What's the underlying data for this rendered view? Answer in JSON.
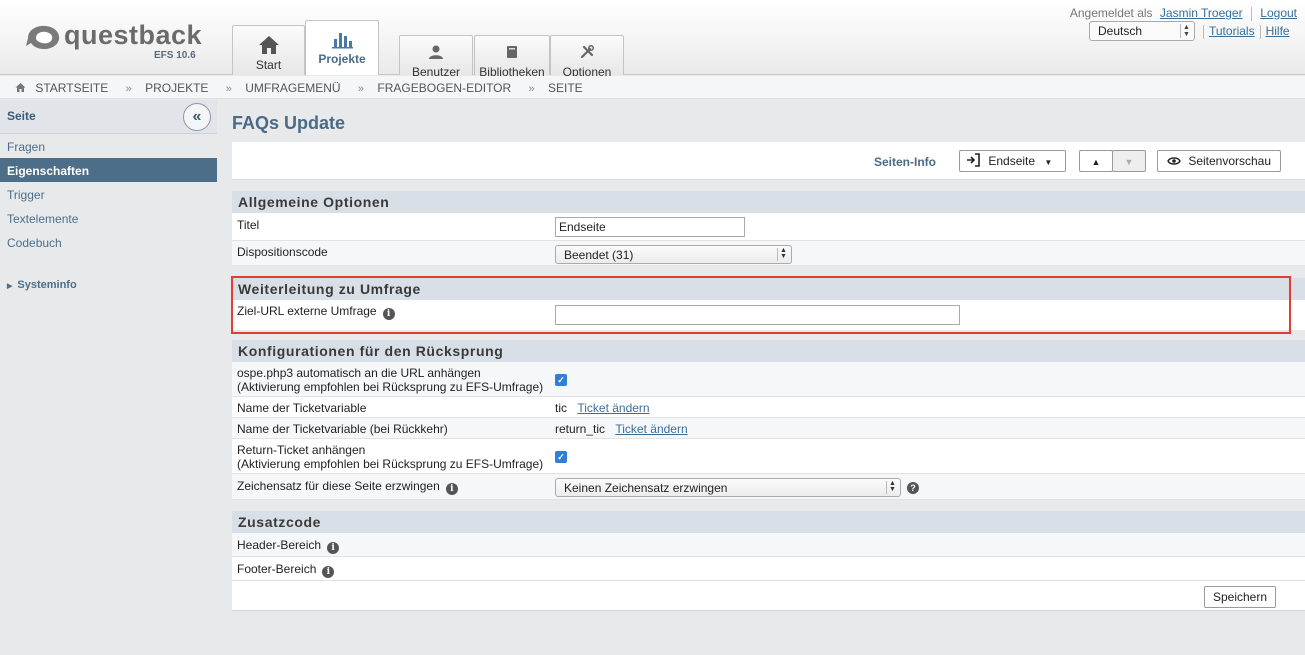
{
  "header": {
    "logo_text": "questback",
    "logo_version": "EFS 10.6",
    "tabs": [
      {
        "label": "Start",
        "icon": "home-icon"
      },
      {
        "label": "Projekte",
        "icon": "bar-chart-icon"
      },
      {
        "label": "Benutzer",
        "icon": "user-icon"
      },
      {
        "label": "Bibliotheken",
        "icon": "library-icon"
      },
      {
        "label": "Optionen",
        "icon": "tools-icon"
      }
    ],
    "logged_in_prefix": "Angemeldet als",
    "user_name": "Jasmin Troeger",
    "logout": "Logout",
    "language": "Deutsch",
    "tutorials": "Tutorials",
    "help": "Hilfe"
  },
  "breadcrumb": [
    "STARTSEITE",
    "PROJEKTE",
    "UMFRAGEMENÜ",
    "FRAGEBOGEN-EDITOR",
    "SEITE"
  ],
  "sidebar": {
    "title": "Seite",
    "items": [
      "Fragen",
      "Eigenschaften",
      "Trigger",
      "Textelemente",
      "Codebuch"
    ],
    "active": "Eigenschaften",
    "systeminfo": "Systeminfo"
  },
  "page": {
    "title": "FAQs Update",
    "seiten_info": "Seiten-Info",
    "endseite_button": "Endseite",
    "preview_button": "Seitenvorschau"
  },
  "sections": {
    "allgemein": {
      "title": "Allgemeine Optionen",
      "titel_label": "Titel",
      "titel_value": "Endseite",
      "disposition_label": "Dispositionscode",
      "disposition_value": "Beendet (31)"
    },
    "weiterleitung": {
      "title": "Weiterleitung zu Umfrage",
      "ziel_url_label": "Ziel-URL externe Umfrage",
      "ziel_url_value": ""
    },
    "ruecksprung": {
      "title": "Konfigurationen für den Rücksprung",
      "ospe_label_1": "ospe.php3 automatisch an die URL anhängen",
      "ospe_label_2": "(Aktivierung empfohlen bei Rücksprung zu EFS-Umfrage)",
      "ticket_label": "Name der Ticketvariable",
      "ticket_value": "tic",
      "ticket_link": "Ticket ändern",
      "ticket_return_label": "Name der Ticketvariable (bei Rückkehr)",
      "ticket_return_value": "return_tic",
      "ticket_return_link": "Ticket ändern",
      "return_ticket_label_1": "Return-Ticket anhängen",
      "return_ticket_label_2": "(Aktivierung empfohlen bei Rücksprung zu EFS-Umfrage)",
      "charset_label": "Zeichensatz für diese Seite erzwingen",
      "charset_value": "Keinen Zeichensatz erzwingen"
    },
    "zusatzcode": {
      "title": "Zusatzcode",
      "header_label": "Header-Bereich",
      "footer_label": "Footer-Bereich"
    }
  },
  "save_button": "Speichern",
  "colors": {
    "highlight_border": "#e43b32",
    "section_header_bg": "#d9dfe6",
    "sidebar_active_bg": "#4d6e88",
    "checkbox": "#2f7fd8"
  }
}
